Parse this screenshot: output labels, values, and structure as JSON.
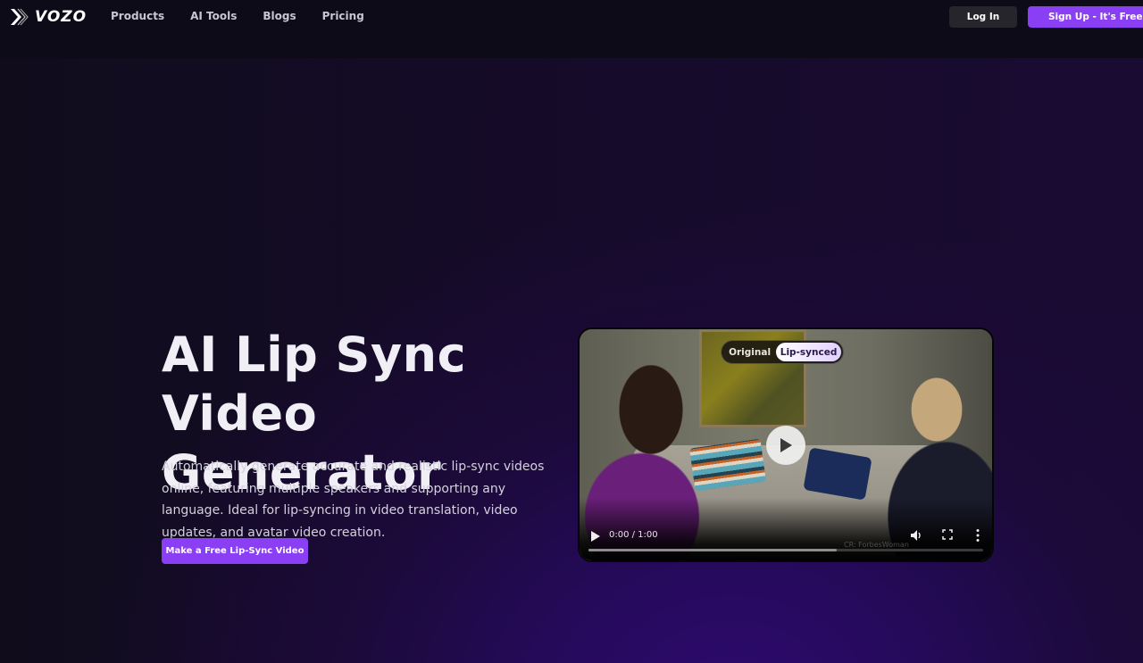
{
  "nav": {
    "logo_text": "VOZO",
    "links": [
      "Products",
      "AI Tools",
      "Blogs",
      "Pricing"
    ],
    "login_label": "Log In",
    "signup_label": "Sign Up - It's Free"
  },
  "hero": {
    "title": "AI Lip Sync Video Generator",
    "description": "Automatically generate accurate and realistic lip-sync videos online, featuring multiple speakers and supporting any language. Ideal for lip-syncing in video translation, video updates, and avatar video creation.",
    "cta_label": "Make a Free Lip-Sync Video"
  },
  "video": {
    "toggle_options": [
      "Original",
      "Lip-synced"
    ],
    "selected_option": "Lip-synced",
    "time_display": "0:00 / 1:00",
    "current_time": "0:00",
    "duration": "1:00",
    "credit": "CR: ForbesWoman",
    "buffered_fraction": 0.63
  },
  "colors": {
    "accent": "#8a3ff4",
    "nav_bg": "#0e0b19",
    "login_bg": "#26252c"
  }
}
